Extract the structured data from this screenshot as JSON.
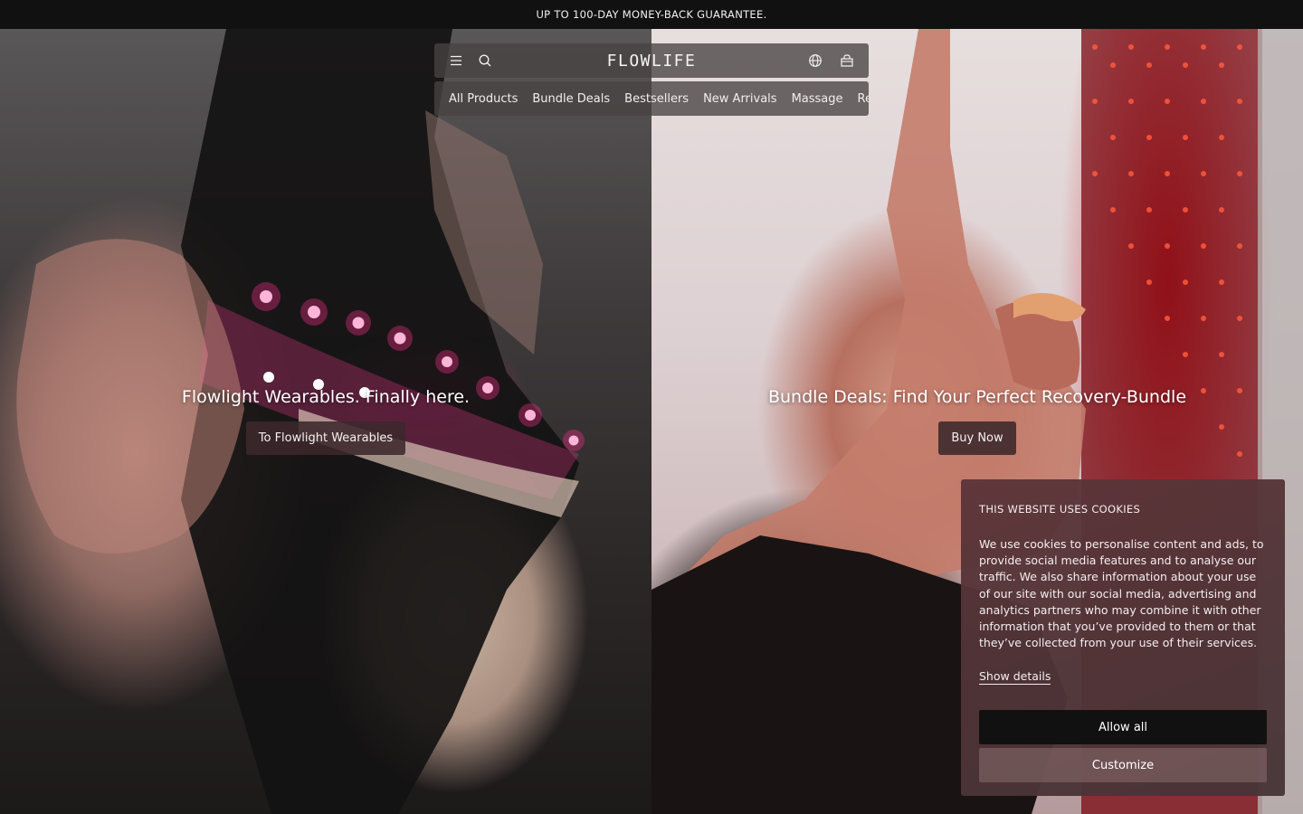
{
  "announcement": "UP TO 100-DAY MONEY-BACK GUARANTEE.",
  "header": {
    "logo": "FLOWLIFE",
    "icons": [
      "menu-icon",
      "search-icon",
      "globe-icon",
      "cart-icon"
    ]
  },
  "nav": {
    "items": [
      "All Products",
      "Bundle Deals",
      "Bestsellers",
      "New Arrivals",
      "Massage",
      "Red"
    ]
  },
  "hero_left": {
    "title": "Flowlight Wearables. Finally here.",
    "button": "To Flowlight Wearables"
  },
  "hero_right": {
    "title": "Bundle Deals: Find Your Perfect Recovery-Bundle",
    "button": "Buy Now"
  },
  "cookie": {
    "title": "THIS WEBSITE USES COOKIES",
    "text": "We use cookies to personalise content and ads, to provide social media features and to analyse our traffic. We also share information about your use of our site with our social media, advertising and analytics partners who may combine it with other information that you’ve provided to them or that they’ve collected from your use of their services.",
    "details_link": "Show details",
    "allow_button": "Allow all",
    "customize_button": "Customize"
  },
  "colors": {
    "announcement_bg": "#111111",
    "cookie_bg": "#5c3438",
    "allow_bg": "#121111",
    "led_pink": "#ff2f8e",
    "panel_red": "#d2141e"
  }
}
